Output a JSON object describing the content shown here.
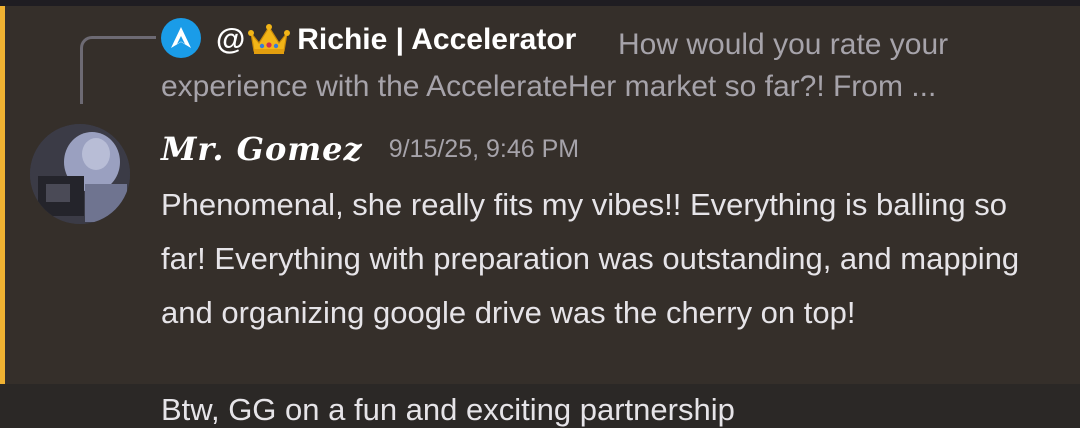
{
  "reply": {
    "author_prefix": "@",
    "author_name": "Richie | Accelerator",
    "preview": "How would you rate your experience with the AccelerateHer market so far?! From ..."
  },
  "message": {
    "author": "Mr. Gomez",
    "timestamp": "9/15/25, 9:46 PM",
    "body": "Phenomenal, she really fits my vibes!! Everything is balling so far! Everything with preparation was outstanding, and mapping and organizing google drive was the cherry on top!"
  },
  "next_message": {
    "body_partial": "Btw, GG on a fun and exciting partnership"
  },
  "colors": {
    "mention_bar": "#f0b232",
    "highlight_bg": "#352f2a",
    "reply_avatar_bg": "#1a9ce8"
  },
  "icons": {
    "reply_avatar": "accelerator-logo-icon",
    "crown": "crown-emoji-icon"
  }
}
